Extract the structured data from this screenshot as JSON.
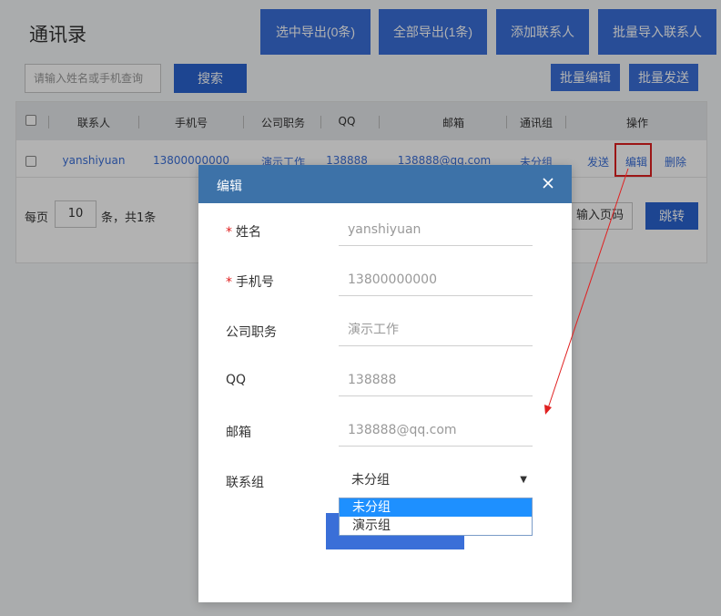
{
  "app": {
    "title": "通讯录"
  },
  "toolbar": {
    "export_selected": "选中导出(0条)",
    "export_all": "全部导出(1条)",
    "add_contact": "添加联系人",
    "batch_import": "批量导入联系人",
    "search_placeholder": "请输入姓名或手机查询",
    "search_button": "搜索",
    "batch_edit": "批量编辑",
    "batch_send": "批量发送"
  },
  "table": {
    "headers": [
      "联系人",
      "手机号",
      "公司职务",
      "QQ",
      "邮箱",
      "通讯组",
      "操作"
    ],
    "rows": [
      {
        "name": "yanshiyuan",
        "phone": "13800000000",
        "title": "演示工作",
        "qq": "138888",
        "email": "138888@qq.com",
        "group": "未分组",
        "actions": [
          "发送",
          "编辑",
          "删除"
        ]
      }
    ]
  },
  "pager": {
    "per_page_label": "每页",
    "per_page_value": "10",
    "summary": "条，共1条",
    "goto_placeholder": "输入页码",
    "jump_button": "跳转"
  },
  "modal": {
    "title": "编辑",
    "fields": [
      {
        "label": "姓名",
        "required": true,
        "value": "yanshiyuan"
      },
      {
        "label": "手机号",
        "required": true,
        "value": "13800000000"
      },
      {
        "label": "公司职务",
        "required": false,
        "value": "演示工作"
      },
      {
        "label": "QQ",
        "required": false,
        "value": "138888"
      },
      {
        "label": "邮箱",
        "required": false,
        "value": "138888@qq.com"
      }
    ],
    "group_label": "联系组",
    "group_selected": "未分组",
    "group_options": [
      "未分组",
      "演示组"
    ]
  },
  "colors": {
    "primary": "#3a6fd8",
    "modal_header": "#3d72a8",
    "highlight": "#e02020",
    "dropdown_active": "#1e90ff"
  }
}
